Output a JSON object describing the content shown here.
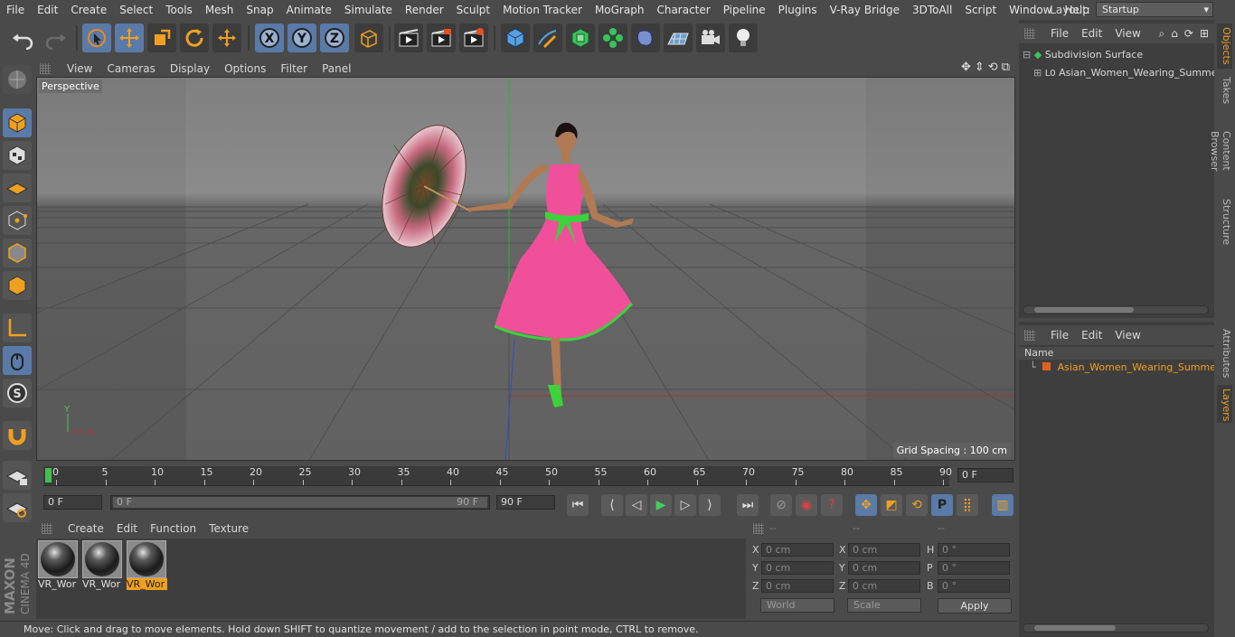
{
  "menubar": {
    "items": [
      "File",
      "Edit",
      "Create",
      "Select",
      "Tools",
      "Mesh",
      "Snap",
      "Animate",
      "Simulate",
      "Render",
      "Sculpt",
      "Motion Tracker",
      "MoGraph",
      "Character",
      "Pipeline",
      "Plugins",
      "V-Ray Bridge",
      "3DToAll",
      "Script",
      "Window",
      "Help"
    ],
    "layout_label": "Layout:",
    "layout_value": "Startup"
  },
  "viewport": {
    "menu": [
      "View",
      "Cameras",
      "Display",
      "Options",
      "Filter",
      "Panel"
    ],
    "camera_label": "Perspective",
    "grid_spacing": "Grid Spacing : 100 cm",
    "axis_y": "Y",
    "axis_x": "X"
  },
  "timeline": {
    "ticks": [
      "0",
      "5",
      "10",
      "15",
      "20",
      "25",
      "30",
      "35",
      "40",
      "45",
      "50",
      "55",
      "60",
      "65",
      "70",
      "75",
      "80",
      "85",
      "90"
    ],
    "current_frame": "0 F"
  },
  "controls": {
    "start_frame": "0 F",
    "range_start": "0 F",
    "range_end": "90 F",
    "end_frame": "90 F"
  },
  "materials": {
    "menu": [
      "Create",
      "Edit",
      "Function",
      "Texture"
    ],
    "items": [
      {
        "label": "VR_Wor",
        "selected": false
      },
      {
        "label": "VR_Wor",
        "selected": false
      },
      {
        "label": "VR_Wor",
        "selected": true
      }
    ]
  },
  "coords": {
    "headers": [
      "--",
      "--",
      "--"
    ],
    "rows": [
      {
        "l1": "X",
        "v1": "0 cm",
        "l2": "X",
        "v2": "0 cm",
        "l3": "H",
        "v3": "0 °"
      },
      {
        "l1": "Y",
        "v1": "0 cm",
        "l2": "Y",
        "v2": "0 cm",
        "l3": "P",
        "v3": "0 °"
      },
      {
        "l1": "Z",
        "v1": "0 cm",
        "l2": "Z",
        "v2": "0 cm",
        "l3": "B",
        "v3": "0 °"
      }
    ],
    "mode": "World",
    "transform": "Scale",
    "apply": "Apply"
  },
  "objects": {
    "menu": [
      "File",
      "Edit",
      "View"
    ],
    "items": [
      "Subdivision Surface",
      "Asian_Women_Wearing_Summer_"
    ]
  },
  "layers": {
    "menu": [
      "File",
      "Edit",
      "View"
    ],
    "column_name": "Name",
    "items": [
      "Asian_Women_Wearing_Summer_"
    ]
  },
  "right_tabs": [
    "Objects",
    "Takes",
    "Content Browser",
    "Structure",
    "Attributes",
    "Layers"
  ],
  "logo": {
    "line1": "MAXON",
    "line2": "CINEMA 4D"
  },
  "status": "Move: Click and drag to move elements. Hold down SHIFT to quantize movement / add to the selection in point mode, CTRL to remove.",
  "colors": {
    "accent": "#f0a020",
    "dress": "#f0509a",
    "sash": "#3cd23c",
    "selection": "#7aa0d0"
  }
}
